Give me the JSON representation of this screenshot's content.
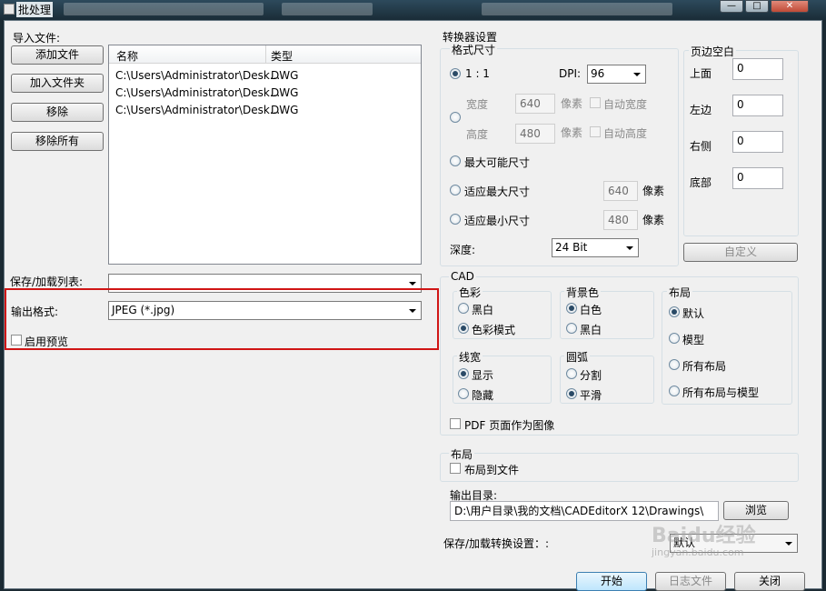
{
  "window": {
    "title": "批处理",
    "close_glyph": "✕",
    "max_glyph": "□",
    "min_glyph": "—"
  },
  "left": {
    "import_label": "导入文件:",
    "buttons": [
      "添加文件",
      "加入文件夹",
      "移除",
      "移除所有"
    ],
    "list_headers": {
      "name": "名称",
      "type": "类型"
    },
    "files": [
      {
        "name": "C:\\Users\\Administrator\\Desk...",
        "type": "DWG"
      },
      {
        "name": "C:\\Users\\Administrator\\Desk...",
        "type": "DWG"
      },
      {
        "name": "C:\\Users\\Administrator\\Desk...",
        "type": "DWG"
      }
    ],
    "save_list_label": "保存/加载列表:",
    "save_list_value": "",
    "output_format_label": "输出格式:",
    "output_format_value": "JPEG (*.jpg)",
    "preview_label": "启用预览"
  },
  "converter": {
    "title": "转换器设置",
    "format_size": {
      "title": "格式尺寸",
      "ratio_label": "1 : 1",
      "dpi_label": "DPI:",
      "dpi_value": "96",
      "width_label": "宽度",
      "width_value": "640",
      "height_label": "高度",
      "height_value": "480",
      "pixel_label": "像素",
      "auto_width": "自动宽度",
      "auto_height": "自动高度",
      "max_possible": "最大可能尺寸",
      "fit_max": "适应最大尺寸",
      "fit_max_value": "640",
      "fit_min": "适应最小尺寸",
      "fit_min_value": "480",
      "depth_label": "深度:",
      "depth_value": "24 Bit"
    },
    "margins": {
      "title": "页边空白",
      "top_label": "上面",
      "top_value": "0",
      "left_label": "左边",
      "left_value": "0",
      "right_label": "右侧",
      "right_value": "0",
      "bottom_label": "底部",
      "bottom_value": "0",
      "custom_button": "自定义"
    },
    "cad": {
      "title": "CAD",
      "color_title": "色彩",
      "color_options": [
        "黑白",
        "色彩模式"
      ],
      "bg_title": "背景色",
      "bg_options": [
        "白色",
        "黑白"
      ],
      "layout_title": "布局",
      "layout_options": [
        "默认",
        "模型",
        "所有布局",
        "所有布局与模型"
      ],
      "lineweight_title": "线宽",
      "lineweight_options": [
        "显示",
        "隐藏"
      ],
      "arc_title": "圆弧",
      "arc_options": [
        "分割",
        "平滑"
      ],
      "pdf_as_image": "PDF 页面作为图像"
    },
    "layout": {
      "title": "布局",
      "layout_to_file": "布局到文件"
    },
    "output_dir": {
      "label": "输出目录:",
      "value": "D:\\用户目录\\我的文档\\CADEditorX 12\\Drawings\\",
      "browse": "浏览"
    },
    "save_settings_label": "保存/加载转换设置：:",
    "save_settings_value": "默认"
  },
  "footer": {
    "start": "开始",
    "log": "日志文件",
    "close": "关闭"
  },
  "watermark": {
    "text": "Baidu经验",
    "sub": "jingyan.baidu.com"
  }
}
